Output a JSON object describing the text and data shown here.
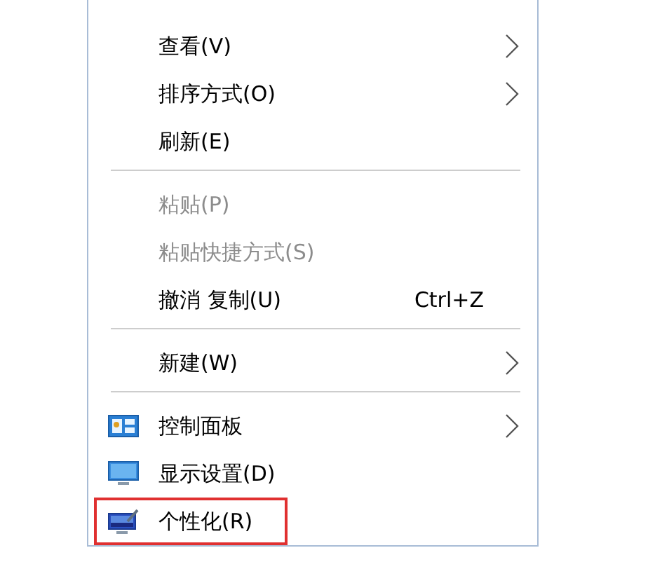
{
  "menu": {
    "items": [
      {
        "kind": "item",
        "label": "查看(V)",
        "submenu": true,
        "disabled": false
      },
      {
        "kind": "item",
        "label": "排序方式(O)",
        "submenu": true,
        "disabled": false
      },
      {
        "kind": "item",
        "label": "刷新(E)",
        "submenu": false,
        "disabled": false
      },
      {
        "kind": "separator"
      },
      {
        "kind": "item",
        "label": "粘贴(P)",
        "submenu": false,
        "disabled": true
      },
      {
        "kind": "item",
        "label": "粘贴快捷方式(S)",
        "submenu": false,
        "disabled": true
      },
      {
        "kind": "item",
        "label": "撤消 复制(U)",
        "shortcut": "Ctrl+Z",
        "submenu": false,
        "disabled": false
      },
      {
        "kind": "separator"
      },
      {
        "kind": "item",
        "label": "新建(W)",
        "submenu": true,
        "disabled": false
      },
      {
        "kind": "separator"
      },
      {
        "kind": "icon-item",
        "label": "控制面板",
        "submenu": true,
        "disabled": false
      },
      {
        "kind": "icon-item",
        "label": "显示设置(D)",
        "submenu": false,
        "disabled": false
      },
      {
        "kind": "icon-item",
        "label": "个性化(R)",
        "submenu": false,
        "disabled": false,
        "highlighted": true
      }
    ]
  }
}
